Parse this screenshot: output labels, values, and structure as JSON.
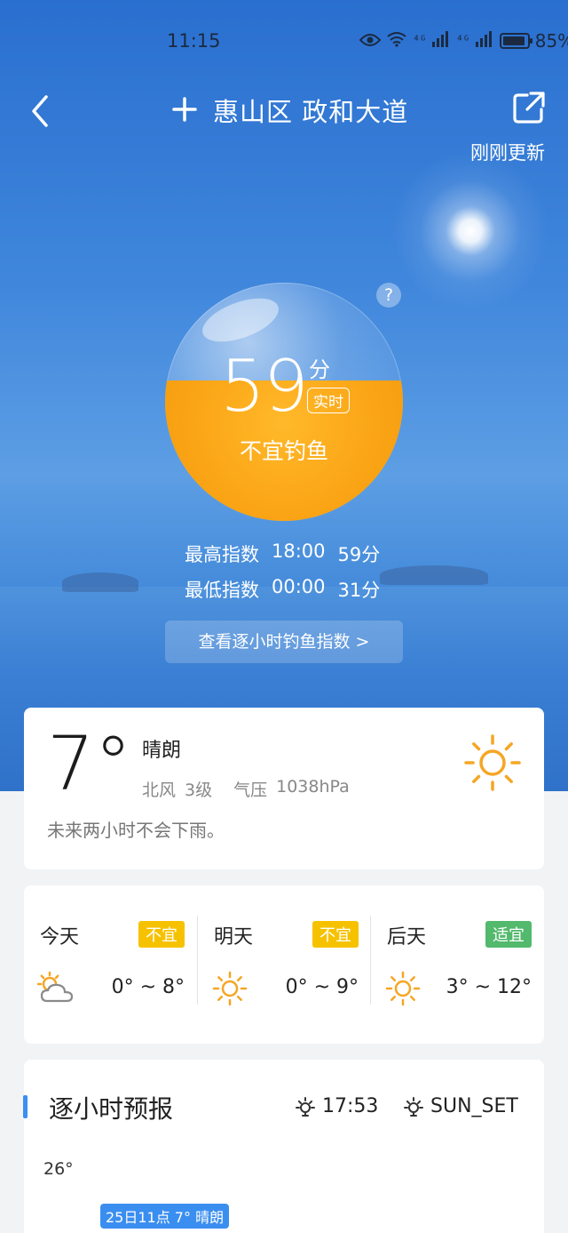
{
  "status_bar": {
    "time": "11:15",
    "battery": "85%",
    "net1": "⁴ᴳ",
    "net2": "⁴ᴳ"
  },
  "header": {
    "location": "惠山区 政和大道",
    "updated": "刚刚更新"
  },
  "fishing_index": {
    "score": "59",
    "unit": "分",
    "tag": "实时",
    "verdict": "不宜钓鱼",
    "fill_fraction": 0.59,
    "help": "?",
    "max": {
      "label": "最高指数",
      "time": "18:00",
      "value": "59分"
    },
    "min": {
      "label": "最低指数",
      "time": "00:00",
      "value": "31分"
    },
    "hourly_link": "查看逐小时钓鱼指数 >"
  },
  "current": {
    "temp": "7°",
    "condition": "晴朗",
    "wind": "北风",
    "wind_level": "3级",
    "pressure_label": "气压",
    "pressure": "1038hPa",
    "note": "未来两小时不会下雨。",
    "icon": "sun-icon"
  },
  "days": [
    {
      "name": "今天",
      "badge": "不宜",
      "badge_color": "#f6c200",
      "range": "0° ~ 8°",
      "icon": "partly-cloudy-icon"
    },
    {
      "name": "明天",
      "badge": "不宜",
      "badge_color": "#f6c200",
      "range": "0° ~ 9°",
      "icon": "sun-icon"
    },
    {
      "name": "后天",
      "badge": "适宜",
      "badge_color": "#52b96d",
      "range": "3° ~ 12°",
      "icon": "sun-icon"
    }
  ],
  "hourly": {
    "title": "逐小时预报",
    "sunrise_time": "17:53",
    "sunset_label": "SUN_SET",
    "max_temp": "26°",
    "chip": "25日11点 7° 晴朗"
  },
  "colors": {
    "accent": "#3a8ef0",
    "index_fill": "#fba617",
    "sun": "#f5a623"
  }
}
